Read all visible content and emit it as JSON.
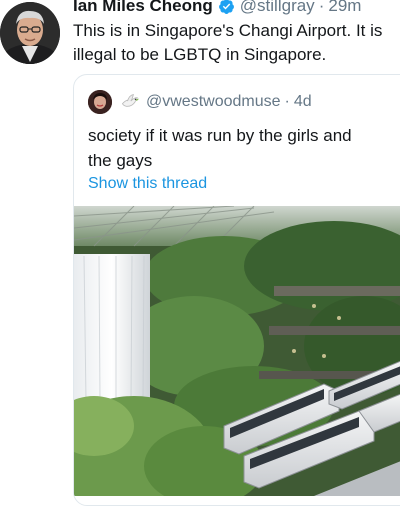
{
  "author": {
    "name": "Ian Miles Cheong",
    "handle": "@stillgray",
    "separator": "·",
    "time": "29m",
    "verified_icon": "verified-badge-icon"
  },
  "tweet": {
    "text_line1": "This is in Singapore's Changi Airport. It is",
    "text_line2": "illegal to be LGBTQ in Singapore."
  },
  "quoted": {
    "emoji_icon": "dove-icon",
    "handle": "@vwestwoodmuse",
    "separator": "·",
    "time": "4d",
    "text_line1": "society if it was run by the girls and",
    "text_line2": "the gays",
    "show_thread": "Show this thread",
    "media_description_icon": "photo-jewel-changi-airport"
  },
  "colors": {
    "text": "#14171a",
    "secondary": "#657786",
    "link": "#1b95e0",
    "verified": "#1da1f2",
    "border": "#e1e8ed"
  }
}
